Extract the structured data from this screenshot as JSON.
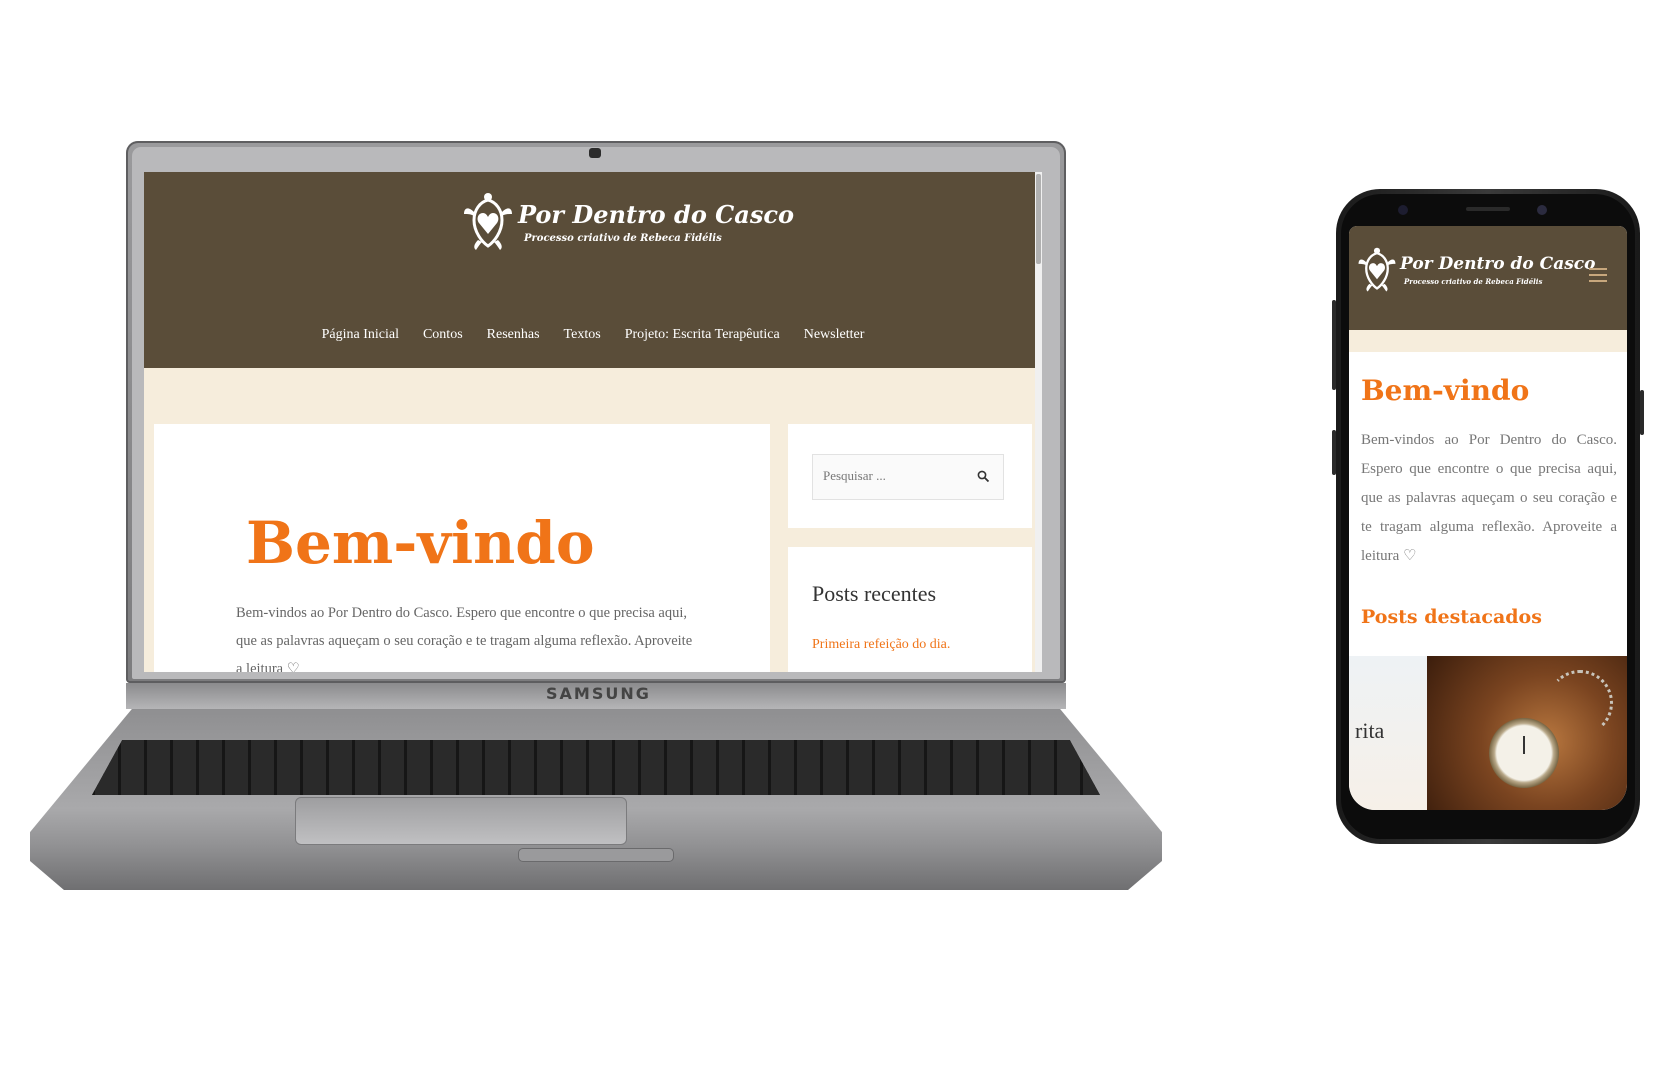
{
  "site": {
    "logo_title": "Por Dentro do Casco",
    "logo_subtitle": "Processo criativo de Rebeca Fidélis",
    "nav": [
      "Página Inicial",
      "Contos",
      "Resenhas",
      "Textos",
      "Projeto: Escrita Terapêutica",
      "Newsletter"
    ],
    "welcome_title": "Bem-vindo",
    "welcome_text_desktop_line1": "Bem-vindos ao Por Dentro do Casco. Espero que encontre o que precisa aqui,",
    "welcome_text_desktop_line2": "que as palavras aqueçam o seu coração e te tragam alguma reflexão. Aproveite",
    "welcome_text_desktop_line3": "a leitura ♡",
    "search_placeholder": "Pesquisar ...",
    "recent_posts_title": "Posts recentes",
    "recent_post_1": "Primeira refeição do dia.",
    "welcome_text_mobile": "Bem-vindos ao Por Dentro do Casco. Espero que encontre o que precisa aqui, que as palavras aqueçam o seu coração e te tragam alguma reflexão. Aproveite a leitura ♡",
    "featured_posts_title": "Posts destacados",
    "featured_left_fragment": "rita"
  },
  "device": {
    "laptop_brand": "SAMSUNG"
  },
  "colors": {
    "header_brown": "#5a4d39",
    "accent_orange": "#f07418",
    "page_beige": "#f6eddc"
  },
  "icons": {
    "search": "magnifier",
    "menu": "hamburger",
    "logo": "turtle-heart"
  }
}
